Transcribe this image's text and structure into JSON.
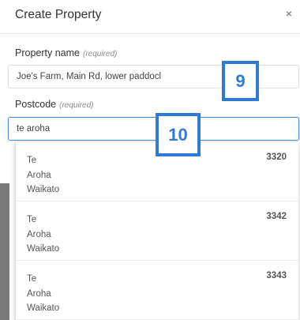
{
  "dialog": {
    "title": "Create Property",
    "close_icon": "close-icon",
    "close_glyph": "×"
  },
  "fields": {
    "name": {
      "label": "Property name",
      "required_hint": "(required)",
      "value": "Joe's Farm, Main Rd, lower paddocl"
    },
    "postcode": {
      "label": "Postcode",
      "required_hint": "(required)",
      "value": "te aroha"
    }
  },
  "markers": {
    "nine": "9",
    "ten": "10"
  },
  "suggestions": [
    {
      "line1": "Te",
      "line2": "Aroha",
      "line3": "Waikato",
      "code": "3320"
    },
    {
      "line1": "Te",
      "line2": "Aroha",
      "line3": "Waikato",
      "code": "3342"
    },
    {
      "line1": "Te",
      "line2": "Aroha",
      "line3": "Waikato",
      "code": "3343"
    }
  ],
  "colors": {
    "marker_blue": "#2f7ad5",
    "focus_border": "#4a90e2"
  }
}
